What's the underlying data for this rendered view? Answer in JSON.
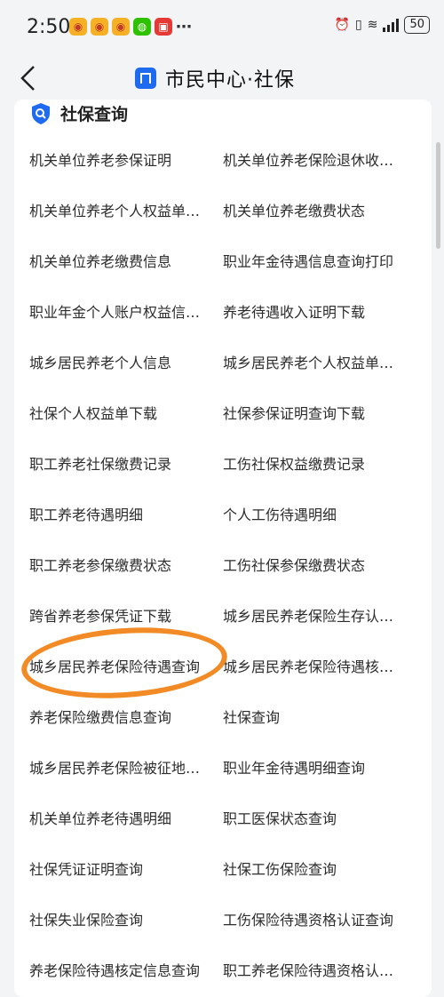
{
  "status_bar": {
    "time": "2:50",
    "notif_icons": [
      "weibo-icon",
      "weibo-icon",
      "weibo-icon",
      "wechat-icon",
      "app-red-icon",
      "more-icon"
    ],
    "battery": "50"
  },
  "nav": {
    "title": "市民中心·社保"
  },
  "section": {
    "title": "社保查询"
  },
  "items": [
    [
      "机关单位养老参保证明",
      "机关单位养老保险退休收…"
    ],
    [
      "机关单位养老个人权益单…",
      "机关单位养老缴费状态"
    ],
    [
      "机关单位养老缴费信息",
      "职业年金待遇信息查询打印"
    ],
    [
      "职业年金个人账户权益信…",
      "养老待遇收入证明下载"
    ],
    [
      "城乡居民养老个人信息",
      "城乡居民养老个人权益单…"
    ],
    [
      "社保个人权益单下载",
      "社保参保证明查询下载"
    ],
    [
      "职工养老社保缴费记录",
      "工伤社保权益缴费记录"
    ],
    [
      "职工养老待遇明细",
      "个人工伤待遇明细"
    ],
    [
      "职工养老参保缴费状态",
      "工伤社保参保缴费状态"
    ],
    [
      "跨省养老参保凭证下载",
      "城乡居民养老保险生存认…"
    ],
    [
      "城乡居民养老保险待遇查询",
      "城乡居民养老保险待遇核…"
    ],
    [
      "养老保险缴费信息查询",
      "社保查询"
    ],
    [
      "城乡居民养老保险被征地…",
      "职业年金待遇明细查询"
    ],
    [
      "机关单位养老待遇明细",
      "职工医保状态查询"
    ],
    [
      "社保凭证证明查询",
      "社保工伤保险查询"
    ],
    [
      "社保失业保险查询",
      "工伤保险待遇资格认证查询"
    ],
    [
      "养老保险待遇核定信息查询",
      "职工养老保险待遇资格认…"
    ]
  ],
  "colors": {
    "accent": "#1e6bf0",
    "highlight": "#f28b26"
  }
}
